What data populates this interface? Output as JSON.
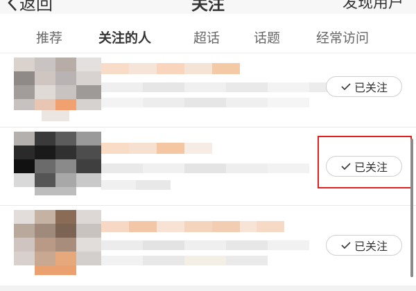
{
  "header": {
    "back_label": "返回",
    "title": "关注",
    "discover_label": "发现用户"
  },
  "tabs": [
    {
      "label": "推荐",
      "active": false
    },
    {
      "label": "关注的人",
      "active": true
    },
    {
      "label": "超话",
      "active": false
    },
    {
      "label": "话题",
      "active": false
    },
    {
      "label": "经常访问",
      "active": false
    }
  ],
  "follow_list": [
    {
      "button_label": "已关注",
      "highlighted": false
    },
    {
      "button_label": "已关注",
      "highlighted": true
    },
    {
      "button_label": "已关注",
      "highlighted": false
    }
  ],
  "colors": {
    "accent": "#ff8200",
    "highlight_box": "#e01f1f",
    "button_border": "#cfcfcf"
  },
  "icons": {
    "back": "chevron-left-icon",
    "follow_check": "checkmark-icon"
  }
}
